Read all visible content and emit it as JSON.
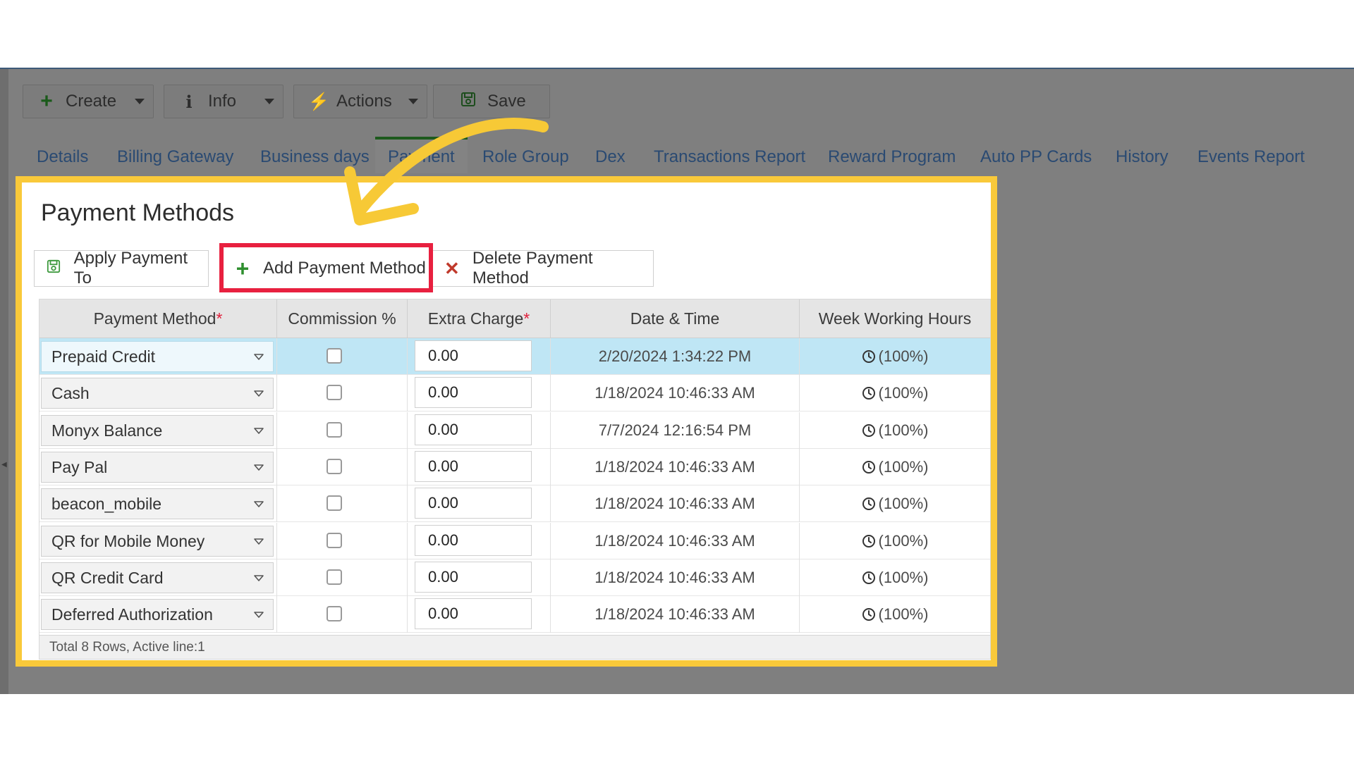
{
  "toolbar": {
    "create_label": "Create",
    "info_label": "Info",
    "actions_label": "Actions",
    "save_label": "Save"
  },
  "tabs": [
    {
      "label": "Details"
    },
    {
      "label": "Billing Gateway"
    },
    {
      "label": "Business days"
    },
    {
      "label": "Payment"
    },
    {
      "label": "Role Group"
    },
    {
      "label": "Dex"
    },
    {
      "label": "Transactions Report"
    },
    {
      "label": "Reward Program"
    },
    {
      "label": "Auto PP Cards"
    },
    {
      "label": "History"
    },
    {
      "label": "Events Report"
    }
  ],
  "panel": {
    "title": "Payment Methods",
    "apply_label": "Apply Payment To",
    "add_label": "Add Payment Method",
    "delete_label": "Delete Payment Method"
  },
  "grid": {
    "headers": {
      "method": "Payment Method",
      "commission": "Commission %",
      "extra": "Extra Charge",
      "datetime": "Date & Time",
      "hours": "Week Working Hours",
      "required_mark": "*"
    },
    "rows": [
      {
        "method": "Prepaid Credit",
        "extra": "0.00",
        "datetime": "2/20/2024 1:34:22 PM",
        "hours": "(100%)"
      },
      {
        "method": "Cash",
        "extra": "0.00",
        "datetime": "1/18/2024 10:46:33 AM",
        "hours": "(100%)"
      },
      {
        "method": "Monyx Balance",
        "extra": "0.00",
        "datetime": "7/7/2024 12:16:54 PM",
        "hours": "(100%)"
      },
      {
        "method": "Pay Pal",
        "extra": "0.00",
        "datetime": "1/18/2024 10:46:33 AM",
        "hours": "(100%)"
      },
      {
        "method": "beacon_mobile",
        "extra": "0.00",
        "datetime": "1/18/2024 10:46:33 AM",
        "hours": "(100%)"
      },
      {
        "method": "QR for Mobile Money",
        "extra": "0.00",
        "datetime": "1/18/2024 10:46:33 AM",
        "hours": "(100%)"
      },
      {
        "method": "QR Credit Card",
        "extra": "0.00",
        "datetime": "1/18/2024 10:46:33 AM",
        "hours": "(100%)"
      },
      {
        "method": "Deferred Authorization",
        "extra": "0.00",
        "datetime": "1/18/2024 10:46:33 AM",
        "hours": "(100%)"
      }
    ],
    "footer": "Total 8 Rows, Active line:1"
  },
  "colors": {
    "highlight_border": "#f9c93a",
    "callout_border": "#e8203f",
    "active_row": "#bfe6f5",
    "tab_text": "#2a4a72"
  }
}
